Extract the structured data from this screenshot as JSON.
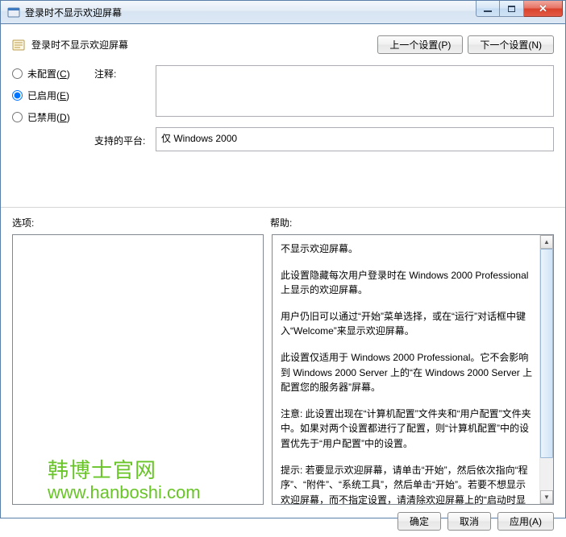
{
  "window": {
    "title": "登录时不显示欢迎屏幕"
  },
  "header": {
    "policy_title": "登录时不显示欢迎屏幕",
    "prev_button": "上一个设置(P)",
    "next_button": "下一个设置(N)"
  },
  "radios": {
    "not_configured": "未配置",
    "not_configured_key": "C",
    "enabled": "已启用",
    "enabled_key": "E",
    "disabled": "已禁用",
    "disabled_key": "D",
    "selected": "enabled"
  },
  "fields": {
    "comment_label": "注释:",
    "comment_value": "",
    "platform_label": "支持的平台:",
    "platform_value": "仅 Windows 2000"
  },
  "lower": {
    "options_label": "选项:",
    "help_label": "帮助:"
  },
  "help": {
    "p1": "不显示欢迎屏幕。",
    "p2": "此设置隐藏每次用户登录时在 Windows 2000 Professional 上显示的欢迎屏幕。",
    "p3": "用户仍旧可以通过“开始”菜单选择，或在“运行”对话框中键入“Welcome”来显示欢迎屏幕。",
    "p4": "此设置仅适用于 Windows 2000 Professional。它不会影响到 Windows 2000 Server 上的“在 Windows 2000 Server 上配置您的服务器”屏幕。",
    "p5": "注意: 此设置出现在“计算机配置”文件夹和“用户配置”文件夹中。如果对两个设置都进行了配置，则“计算机配置”中的设置优先于“用户配置”中的设置。",
    "p6": "提示: 若要显示欢迎屏幕，请单击“开始”，然后依次指向“程序”、“附件”、“系统工具”，然后单击“开始”。若要不想显示欢迎屏幕，而不指定设置，请清除欢迎屏幕上的“启动时显示此屏"
  },
  "footer": {
    "ok": "确定",
    "cancel": "取消",
    "apply": "应用(A)"
  },
  "watermark": {
    "line1": "韩博士官网",
    "line2": "www.hanboshi.com"
  }
}
